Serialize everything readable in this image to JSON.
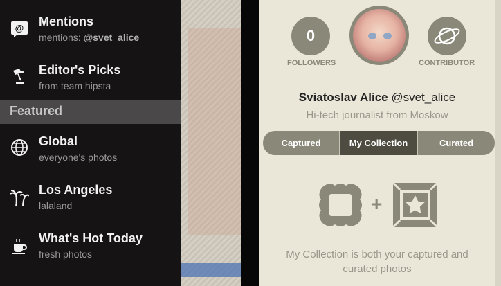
{
  "sidebar": {
    "items": [
      {
        "icon": "at-speech-icon",
        "title": "Mentions",
        "subtitle_prefix": "mentions: ",
        "subtitle_handle": "@svet_alice"
      },
      {
        "icon": "lamp-icon",
        "title": "Editor's Picks",
        "subtitle": "from team hipsta"
      }
    ],
    "section_label": "Featured",
    "featured": [
      {
        "icon": "globe-icon",
        "title": "Global",
        "subtitle": "everyone's photos"
      },
      {
        "icon": "palm-trees-icon",
        "title": "Los Angeles",
        "subtitle": "lalaland"
      },
      {
        "icon": "coffee-cup-icon",
        "title": "What's Hot Today",
        "subtitle": "fresh photos"
      }
    ]
  },
  "profile": {
    "followers_count": "0",
    "followers_label": "FOLLOWERS",
    "contributor_label": "CONTRIBUTOR",
    "name": "Sviatoslav Alice",
    "handle": "@svet_alice",
    "bio": "Hi-tech journalist from Moskow",
    "tabs": [
      {
        "label": "Captured",
        "active": false
      },
      {
        "label": "My Collection",
        "active": true
      },
      {
        "label": "Curated",
        "active": false
      }
    ],
    "plus": "+",
    "caption_line1": "My Collection is both your captured and",
    "caption_line2": "curated photos"
  },
  "colors": {
    "sidebar_bg": "#151313",
    "section_bg": "#4a4848",
    "panel_bg": "#ebe7d8",
    "accent": "#8a8878",
    "active_tab": "#4e4c40"
  }
}
